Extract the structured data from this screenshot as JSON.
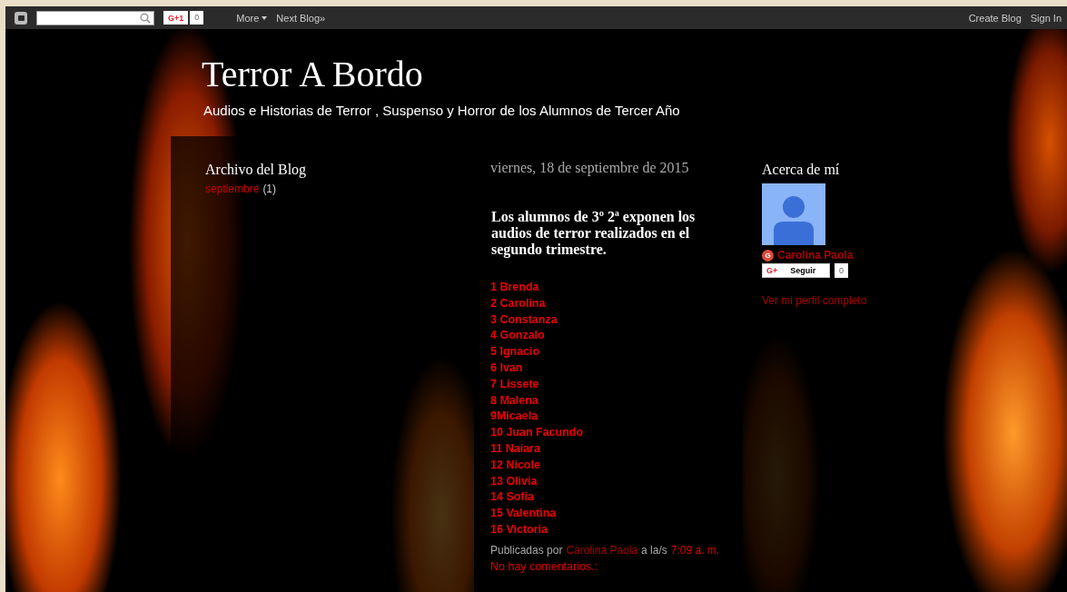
{
  "navbar": {
    "gplus": {
      "label": "G+1",
      "count": "0"
    },
    "links": [
      "More",
      "Next Blog»"
    ],
    "right_links": [
      "Create Blog",
      "Sign In"
    ]
  },
  "header": {
    "title": "Terror A Bordo",
    "description": "Audios e Historias de Terror , Suspenso y Horror de los Alumnos de Tercer Año"
  },
  "archive": {
    "title": "Archivo del Blog",
    "items": [
      {
        "label": "septiembre",
        "count": "(1)"
      }
    ]
  },
  "post": {
    "date": "viernes, 18 de septiembre de 2015",
    "title": "Los alumnos de 3º 2ª exponen los audios de terror realizados en el segundo trimestre.",
    "links": [
      "1 Brenda",
      "2 Carolina",
      "3 Constanza",
      "4 Gonzalo",
      "5 Ignacio",
      "6 Ivan",
      "7 Lissete",
      "8 Malena",
      "9Micaela",
      "10 Juan Facundo",
      "11 Naiara",
      "12 Nicole",
      "13 Olivia",
      "14 Sofia",
      "15 Valentina",
      "16 Victoria"
    ],
    "footer": {
      "prefix": "Publicadas por",
      "author": "Carolina Paola",
      "middle": "a la/s",
      "time": "7:09 a. m.",
      "comments": "No hay comentarios.:"
    }
  },
  "about": {
    "title": "Acerca de mí",
    "badge": "G",
    "name": "Carolina Paola",
    "follow": {
      "icon": "G+",
      "label": "Seguir",
      "count": "0"
    },
    "profile_link": "Ver mi perfil completo"
  }
}
